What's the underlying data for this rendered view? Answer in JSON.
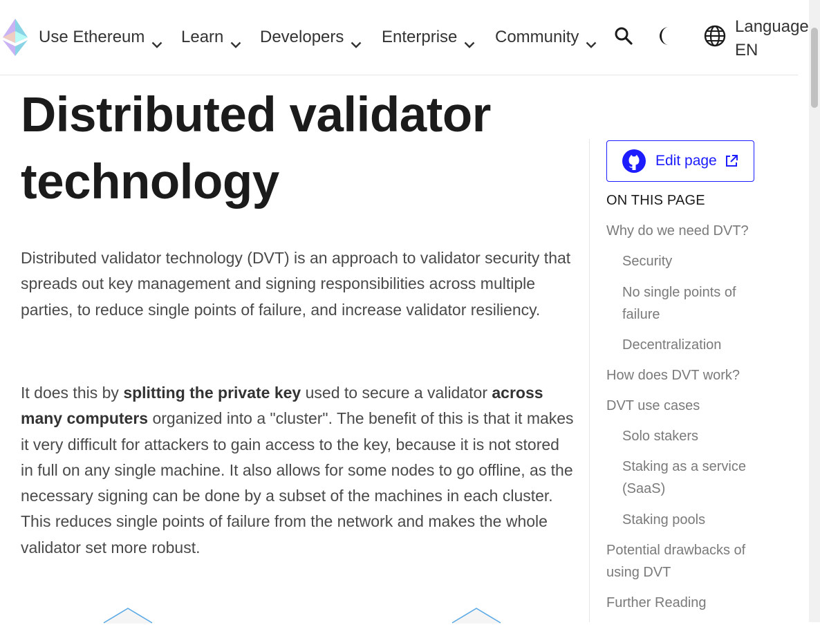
{
  "header": {
    "nav": [
      {
        "label": "Use Ethereum"
      },
      {
        "label": "Learn"
      },
      {
        "label": "Developers"
      },
      {
        "label": "Enterprise"
      },
      {
        "label": "Community"
      }
    ],
    "language_label": "Language",
    "language_code": "EN"
  },
  "main": {
    "title": "Distributed validator technology",
    "para1": "Distributed validator technology (DVT) is an approach to validator security that spreads out key management and signing responsibilities across multiple parties, to reduce single points of failure, and increase validator resiliency.",
    "para2": {
      "t1": "It does this by ",
      "b1": "splitting the private key",
      "t2": " used to secure a validator ",
      "b2": "across many computers",
      "t3": " organized into a \"cluster\". The benefit of this is that it makes it very difficult for attackers to gain access to the key, because it is not stored in full on any single machine. It also allows for some nodes to go offline, as the necessary signing can be done by a subset of the machines in each cluster. This reduces single points of failure from the network and makes the whole validator set more robust."
    }
  },
  "sidebar": {
    "edit_label": "Edit page",
    "toc_heading": "ON THIS PAGE",
    "toc": [
      {
        "label": "Why do we need DVT?"
      },
      {
        "label": "Security"
      },
      {
        "label": "No single points of failure"
      },
      {
        "label": "Decentralization"
      },
      {
        "label": "How does DVT work?"
      },
      {
        "label": "DVT use cases"
      },
      {
        "label": "Solo stakers"
      },
      {
        "label": "Staking as a service (SaaS)"
      },
      {
        "label": "Staking pools"
      },
      {
        "label": "Potential drawbacks of using DVT"
      },
      {
        "label": "Further Reading"
      }
    ]
  },
  "colors": {
    "accent": "#1c1cff",
    "text": "#333333",
    "muted": "#7a7a7a",
    "diagram": "#5aa9e6"
  },
  "icons": [
    "ethereum-logo",
    "chevron-down-icon",
    "search-icon",
    "moon-icon",
    "globe-icon",
    "github-icon",
    "external-link-icon"
  ]
}
